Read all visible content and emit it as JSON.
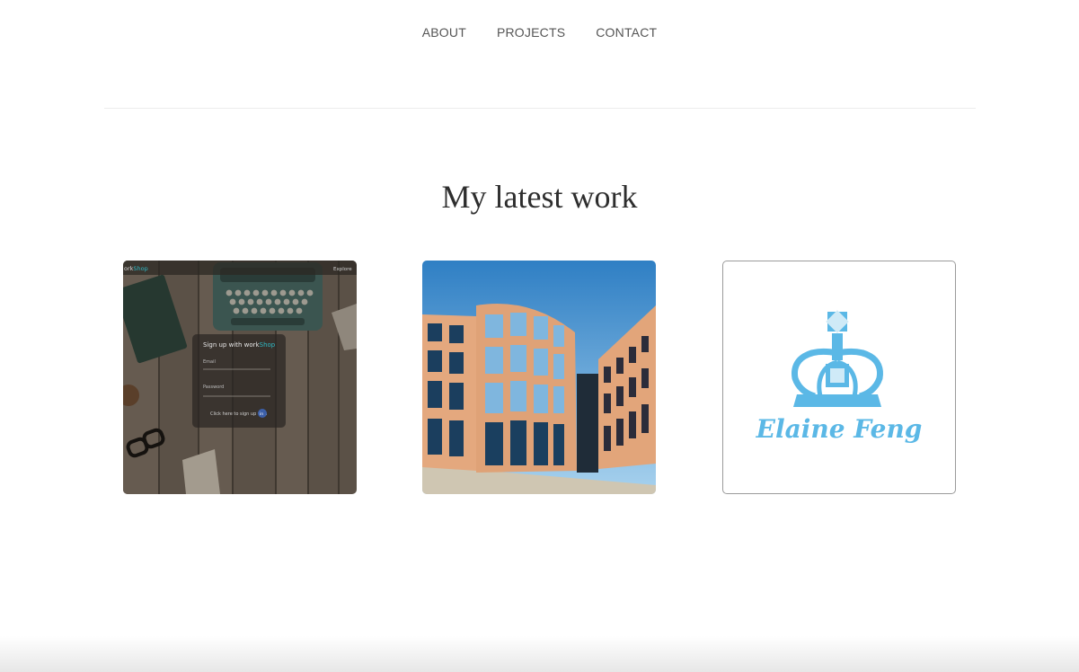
{
  "nav": {
    "items": [
      {
        "label": "ABOUT"
      },
      {
        "label": "PROJECTS"
      },
      {
        "label": "CONTACT"
      }
    ]
  },
  "main": {
    "heading": "My latest work"
  },
  "projects": [
    {
      "icon": "workshop-signup-thumbnail",
      "brand_prefix": "ork",
      "brand_accent": "Shop",
      "nav_right": "Explore",
      "form_title": "Sign up with work",
      "form_title_accent": "Shop",
      "email_label": "Email",
      "password_label": "Password",
      "footer_text": "Click here to sign up with",
      "footer_badge": "in"
    },
    {
      "icon": "buildings-painting-thumbnail"
    },
    {
      "icon": "crown-logo-thumbnail",
      "logo_text": "Elaine Feng",
      "logo_color": "#5bb8e6"
    }
  ]
}
